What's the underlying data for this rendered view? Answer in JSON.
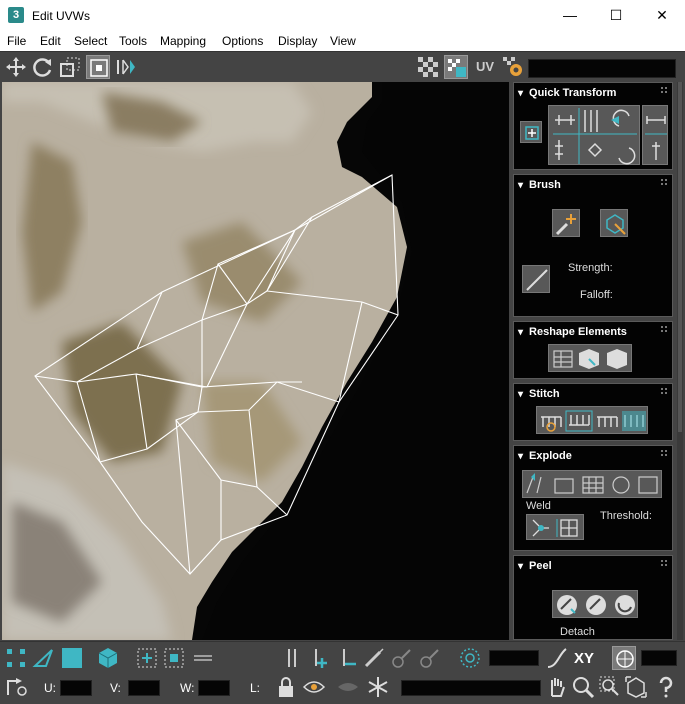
{
  "window": {
    "app_icon_glyph": "3",
    "title": "Edit UVWs",
    "minimize": "—",
    "maximize": "☐",
    "close": "✕"
  },
  "menu": [
    "File",
    "Edit",
    "Select",
    "Tools",
    "Mapping",
    "Options",
    "Display",
    "View"
  ],
  "toolbar": {
    "uv_label": "UV",
    "icons": [
      "move-icon",
      "rotate-icon",
      "scale-icon",
      "freeform-icon",
      "mirror-icon",
      "checker-icon",
      "texture-icon",
      "uv-toggle-icon",
      "settings-icon"
    ]
  },
  "rollouts": {
    "quick_transform": {
      "title": "Quick Transform"
    },
    "brush": {
      "title": "Brush",
      "strength_label": "Strength:",
      "falloff_label": "Falloff:"
    },
    "reshape": {
      "title": "Reshape Elements"
    },
    "stitch": {
      "title": "Stitch"
    },
    "explode": {
      "title": "Explode",
      "weld_label": "Weld",
      "threshold_label": "Threshold:"
    },
    "peel": {
      "title": "Peel",
      "detach_label": "Detach"
    }
  },
  "status": {
    "xy_label": "XY",
    "u_label": "U:",
    "v_label": "V:",
    "w_label": "W:",
    "l_label": "L:"
  },
  "colors": {
    "accent": "#3fb7c4",
    "panel_bg": "#444444",
    "rollout_bg": "#030303",
    "uv_wire": "#ffffff"
  }
}
